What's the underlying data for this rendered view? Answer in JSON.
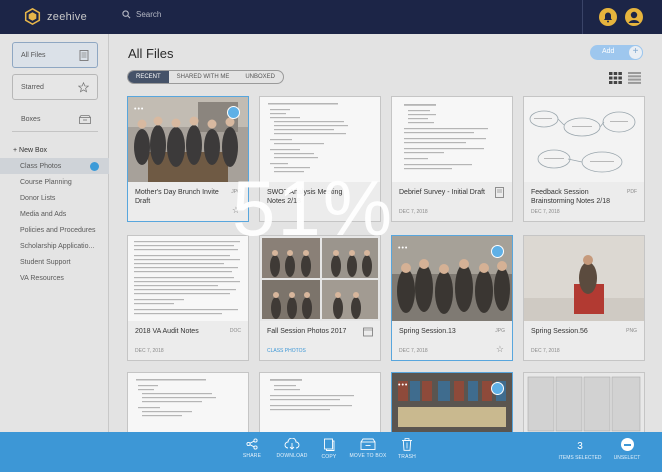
{
  "app": {
    "logo_text": "zeehive"
  },
  "topbar": {
    "search_placeholder": "Search"
  },
  "sidebar": {
    "all_files": "All Files",
    "starred": "Starred",
    "boxes": "Boxes",
    "new_box": "+ New Box",
    "items": [
      {
        "label": "Class Photos",
        "selected": true
      },
      {
        "label": "Course Planning"
      },
      {
        "label": "Donor Lists"
      },
      {
        "label": "Media and Ads"
      },
      {
        "label": "Policies and Procedures"
      },
      {
        "label": "Scholarship Applicatio..."
      },
      {
        "label": "Student Support"
      },
      {
        "label": "VA Resources"
      }
    ]
  },
  "main": {
    "title": "All Files",
    "add_label": "Add",
    "tabs": [
      "RECENT",
      "SHARED WITH ME",
      "UNBOXED"
    ],
    "active_tab": "RECENT"
  },
  "cards": [
    {
      "name": "Mother's Day Brunch Invite Draft",
      "ext": "JPG",
      "date": "",
      "selected": true
    },
    {
      "name": "SWOT Analysis Meeting Notes 2/18",
      "ext": "",
      "date": ""
    },
    {
      "name": "Debrief Survey - Initial Draft",
      "ext": "",
      "date": "DEC 7, 2018"
    },
    {
      "name": "Feedback Session Brainstorming Notes 2/18",
      "ext": "PDF",
      "date": "DEC 7, 2018"
    },
    {
      "name": "2018 VA Audit Notes",
      "ext": "DOC",
      "date": "DEC 7, 2018"
    },
    {
      "name": "Fall Session Photos 2017",
      "ext": "",
      "date": "CLASS PHOTOS"
    },
    {
      "name": "Spring Session.13",
      "ext": "JPG",
      "date": "DEC 7, 2018",
      "selected": true
    },
    {
      "name": "Spring Session.56",
      "ext": "PNG",
      "date": "DEC 7, 2018"
    }
  ],
  "overlay": {
    "progress_text": "51%",
    "progress": 0.51
  },
  "actionbar": {
    "share": "SHARE",
    "download": "DOWNLOAD",
    "copy": "COPY",
    "move": "MOVE TO BOX",
    "trash": "TRASH",
    "count": "3",
    "count_label": "ITEMS SELECTED",
    "unselect": "UNSELECT"
  },
  "colors": {
    "navy": "#1c2547",
    "accent": "#3d97d6",
    "select": "#58a6dd"
  }
}
